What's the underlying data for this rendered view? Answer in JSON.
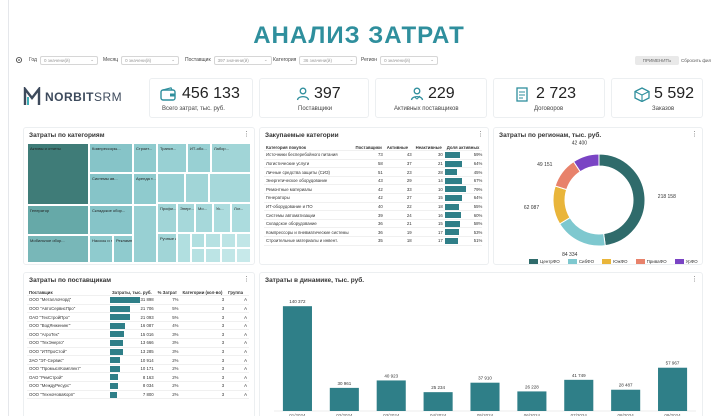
{
  "title": "АНАЛИЗ ЗАТРАТ",
  "filters": {
    "items": [
      {
        "label": "Год",
        "value": "0 значени(й)"
      },
      {
        "label": "Месяц",
        "value": "0 значени(й)"
      },
      {
        "label": "Поставщик",
        "value": "397 значени(й)"
      },
      {
        "label": "Категория",
        "value": "36 значени(й)"
      },
      {
        "label": "Регион",
        "value": "0 значени(й)"
      }
    ],
    "apply_label": "ПРИМЕНИТЬ",
    "reset_label": "Сбросить фильтр"
  },
  "logo": {
    "text_main": "NORBIT",
    "text_suffix": "SRM"
  },
  "kpis": [
    {
      "value": "456 133",
      "label": "Всего затрат, тыс. руб.",
      "icon": "wallet-icon"
    },
    {
      "value": "397",
      "label": "Поставщики",
      "icon": "person-icon"
    },
    {
      "value": "229",
      "label": "Активных поставщиков",
      "icon": "active-person-icon"
    },
    {
      "value": "2 723",
      "label": "Договоров",
      "icon": "contract-icon"
    },
    {
      "value": "5 592",
      "label": "Заказов",
      "icon": "box-icon"
    }
  ],
  "treemap": {
    "title": "Затраты по категориям",
    "tiles": [
      "Активы и отчеты",
      "Генератор",
      "Мобильное обор...",
      "Компрессоры...",
      "Системы ав...",
      "Аренда т...",
      "Складское обор...",
      "Насосы и на...",
      "Рекламные ...",
      "Строит...",
      "Трансп...",
      "ИТ-обо...",
      "Лабор...",
      "Профи...",
      "Энерг...",
      "Ручные и...",
      "Мо...",
      "Ус...",
      "Лог..."
    ]
  },
  "categories": {
    "title": "Закупаемые категории",
    "headers": [
      "Категория покупок",
      "Поставщики",
      "Активные",
      "Неактивные",
      "Доля активных"
    ],
    "rows": [
      {
        "name": "Источники бесперебойного питания",
        "sup": "73",
        "act": "43",
        "inact": "30",
        "share": "59%",
        "pct": 59
      },
      {
        "name": "Логистические услуги",
        "sup": "58",
        "act": "37",
        "inact": "21",
        "share": "64%",
        "pct": 64
      },
      {
        "name": "Личные средства защиты (СИЗ)",
        "sup": "51",
        "act": "23",
        "inact": "28",
        "share": "45%",
        "pct": 45
      },
      {
        "name": "Энергетическое оборудование",
        "sup": "43",
        "act": "29",
        "inact": "14",
        "share": "67%",
        "pct": 67
      },
      {
        "name": "Ремонтные материалы",
        "sup": "42",
        "act": "33",
        "inact": "10",
        "share": "79%",
        "pct": 79
      },
      {
        "name": "Генераторы",
        "sup": "42",
        "act": "27",
        "inact": "15",
        "share": "64%",
        "pct": 64
      },
      {
        "name": "ИТ-оборудование и ПО",
        "sup": "40",
        "act": "22",
        "inact": "18",
        "share": "55%",
        "pct": 55
      },
      {
        "name": "Системы автоматизации",
        "sup": "39",
        "act": "24",
        "inact": "16",
        "share": "60%",
        "pct": 60
      },
      {
        "name": "Складское оборудование",
        "sup": "36",
        "act": "21",
        "inact": "15",
        "share": "58%",
        "pct": 58
      },
      {
        "name": "Компрессоры и пневматические системы",
        "sup": "36",
        "act": "19",
        "inact": "17",
        "share": "53%",
        "pct": 53
      },
      {
        "name": "Строительные материалы и инвент.",
        "sup": "35",
        "act": "18",
        "inact": "17",
        "share": "51%",
        "pct": 51
      }
    ]
  },
  "regions": {
    "title": "Затраты по регионам, тыс. руб.",
    "legend": [
      {
        "name": "ЦентрФО",
        "color": "#2f6b6b"
      },
      {
        "name": "СибФО",
        "color": "#7ec8cf"
      },
      {
        "name": "ЮжФО",
        "color": "#e9b53a"
      },
      {
        "name": "ПриваФО",
        "color": "#e8826b"
      },
      {
        "name": "УрФО",
        "color": "#7a44c4"
      }
    ]
  },
  "suppliers": {
    "title": "Затраты по поставщикам",
    "headers": [
      "Поставщик",
      "Затраты, тыс. руб.",
      "% Затрат",
      "Категории (кол-во)",
      "Группа"
    ],
    "rows": [
      {
        "name": "ООО \"МеталлоНорд\"",
        "cost": "31 898",
        "pct": "7%",
        "cats": "3",
        "grp": "A",
        "bar": 100
      },
      {
        "name": "ООО \"АвтоСервисПро\"",
        "cost": "21 706",
        "pct": "5%",
        "cats": "3",
        "grp": "A",
        "bar": 68
      },
      {
        "name": "ОАО \"ТехСтройПро\"",
        "cost": "21 093",
        "pct": "5%",
        "cats": "3",
        "grp": "A",
        "bar": 66
      },
      {
        "name": "ООО \"ВодЯнженинг\"",
        "cost": "16 087",
        "pct": "4%",
        "cats": "3",
        "grp": "A",
        "bar": 50
      },
      {
        "name": "ООО \"АгроТех\"",
        "cost": "15 016",
        "pct": "3%",
        "cats": "3",
        "grp": "A",
        "bar": 47
      },
      {
        "name": "ООО \"ТехЭнерго\"",
        "cost": "13 666",
        "pct": "3%",
        "cats": "3",
        "grp": "A",
        "bar": 43
      },
      {
        "name": "ООО \"ИТПроСтой\"",
        "cost": "13 285",
        "pct": "3%",
        "cats": "3",
        "grp": "A",
        "bar": 42
      },
      {
        "name": "ЗАО \"ЭТ-Сервис\"",
        "cost": "10 914",
        "pct": "2%",
        "cats": "3",
        "grp": "A",
        "bar": 34
      },
      {
        "name": "ООО \"ПромыслКомплект\"",
        "cost": "10 171",
        "pct": "2%",
        "cats": "3",
        "grp": "A",
        "bar": 32
      },
      {
        "name": "ОАО \"РемСтрой\"",
        "cost": "8 163",
        "pct": "2%",
        "cats": "3",
        "grp": "A",
        "bar": 26
      },
      {
        "name": "ООО \"МеждуРесурс\"",
        "cost": "8 034",
        "pct": "2%",
        "cats": "3",
        "grp": "A",
        "bar": 25
      },
      {
        "name": "ООО \"ТехноНоваКорп\"",
        "cost": "7 800",
        "pct": "2%",
        "cats": "3",
        "grp": "A",
        "bar": 24
      }
    ]
  },
  "dynamics": {
    "title": "Затраты в динамике, тыс. руб."
  },
  "chart_data": [
    {
      "type": "pie",
      "title": "Затраты по регионам, тыс. руб.",
      "categories": [
        "ЦентрФО",
        "СибФО",
        "ЮжФО",
        "ПриваФО",
        "УрФО"
      ],
      "values": [
        218158,
        84334,
        62087,
        49151,
        42400
      ],
      "labels": [
        "218 158",
        "84 334",
        "62 087",
        "49 151",
        "42 400"
      ],
      "colors": [
        "#2f6b6b",
        "#7ec8cf",
        "#e9b53a",
        "#e8826b",
        "#7a44c4"
      ]
    },
    {
      "type": "bar",
      "title": "Затраты в динамике, тыс. руб.",
      "categories": [
        "01/2024",
        "02/2024",
        "03/2024",
        "04/2024",
        "05/2024",
        "06/2024",
        "07/2024",
        "08/2024",
        "09/2024"
      ],
      "values": [
        140372,
        30961,
        40923,
        25234,
        37910,
        26228,
        41749,
        28487,
        57967
      ],
      "labels": [
        "140 372",
        "30 961",
        "40 923",
        "25 234",
        "37 910",
        "26 228",
        "41 749",
        "28 487",
        "57 967"
      ],
      "ylim": [
        0,
        150000
      ],
      "color": "#2f7f88"
    }
  ]
}
